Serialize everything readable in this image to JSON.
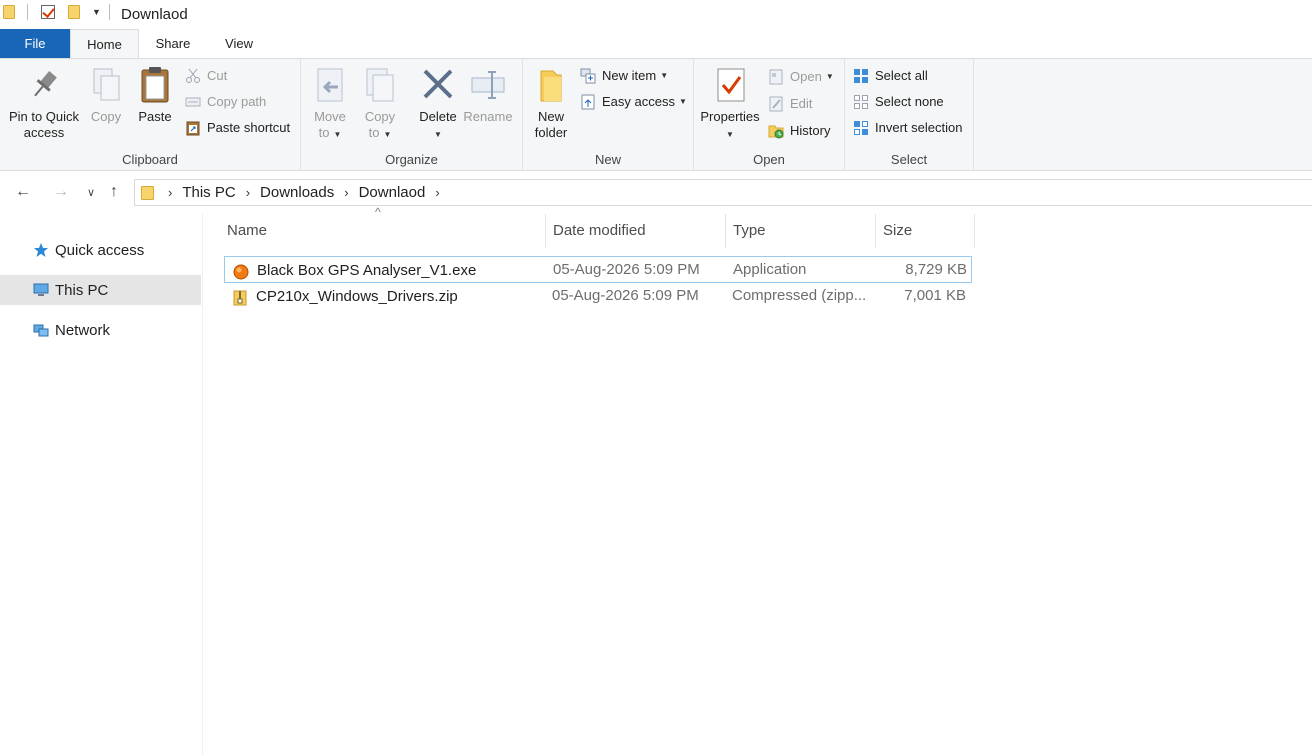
{
  "window": {
    "title": "Downlaod"
  },
  "tabs": {
    "file": "File",
    "home": "Home",
    "share": "Share",
    "view": "View"
  },
  "ribbon": {
    "clipboard": {
      "label": "Clipboard",
      "pin_line1": "Pin to Quick",
      "pin_line2": "access",
      "copy": "Copy",
      "paste": "Paste",
      "cut": "Cut",
      "copy_path": "Copy path",
      "paste_shortcut": "Paste shortcut"
    },
    "organize": {
      "label": "Organize",
      "move_line1": "Move",
      "move_line2": "to",
      "copy_line1": "Copy",
      "copy_line2": "to",
      "delete": "Delete",
      "rename": "Rename"
    },
    "new": {
      "label": "New",
      "folder_line1": "New",
      "folder_line2": "folder",
      "new_item": "New item",
      "easy_access": "Easy access"
    },
    "open": {
      "label": "Open",
      "properties": "Properties",
      "open": "Open",
      "edit": "Edit",
      "history": "History"
    },
    "select": {
      "label": "Select",
      "select_all": "Select all",
      "select_none": "Select none",
      "invert": "Invert selection"
    }
  },
  "breadcrumb": [
    "This PC",
    "Downloads",
    "Downlaod"
  ],
  "sidebar": {
    "items": [
      {
        "label": "Quick access",
        "icon": "star-icon"
      },
      {
        "label": "This PC",
        "icon": "computer-icon"
      },
      {
        "label": "Network",
        "icon": "network-icon"
      }
    ]
  },
  "columns": {
    "name": "Name",
    "date": "Date modified",
    "type": "Type",
    "size": "Size"
  },
  "files": [
    {
      "name": "Black Box GPS Analyser_V1.exe",
      "date": "05-Aug-2026 5:09 PM",
      "type": "Application",
      "size": "8,729 KB",
      "icon": "exe-icon"
    },
    {
      "name": "CP210x_Windows_Drivers.zip",
      "date": "05-Aug-2026 5:09 PM",
      "type": "Compressed (zipp...",
      "size": "7,001 KB",
      "icon": "zip-icon"
    }
  ],
  "colors": {
    "file_tab": "#1966b7",
    "selection_border": "#99c9ef"
  }
}
